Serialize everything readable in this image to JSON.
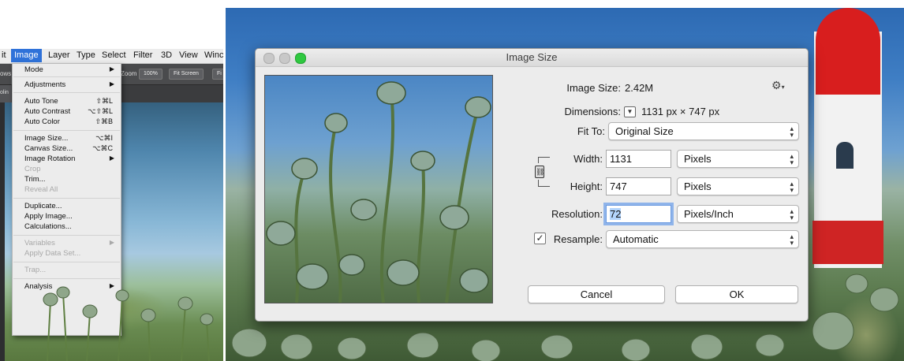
{
  "left": {
    "menubar": [
      "it",
      "Image",
      "Layer",
      "Type",
      "Select",
      "Filter",
      "3D",
      "View",
      "Winc"
    ],
    "options_bar": {
      "zoom_label": "Zoom",
      "zoom_value": "100%",
      "fit_screen": "Fit Screen",
      "stub": "Fi",
      "left_stub": "ows"
    },
    "tab_stub": "olin",
    "menu": [
      {
        "label": "Mode",
        "arrow": true
      },
      {
        "label": "Adjustments",
        "arrow": true
      },
      {
        "label": "Auto Tone",
        "shortcut": "⇧⌘L"
      },
      {
        "label": "Auto Contrast",
        "shortcut": "⌥⇧⌘L"
      },
      {
        "label": "Auto Color",
        "shortcut": "⇧⌘B"
      },
      {
        "label": "Image Size...",
        "shortcut": "⌥⌘I"
      },
      {
        "label": "Canvas Size...",
        "shortcut": "⌥⌘C"
      },
      {
        "label": "Image Rotation",
        "arrow": true
      },
      {
        "label": "Crop",
        "disabled": true
      },
      {
        "label": "Trim..."
      },
      {
        "label": "Reveal All",
        "disabled": true
      },
      {
        "label": "Duplicate..."
      },
      {
        "label": "Apply Image..."
      },
      {
        "label": "Calculations..."
      },
      {
        "label": "Variables",
        "arrow": true,
        "disabled": true
      },
      {
        "label": "Apply Data Set...",
        "disabled": true
      },
      {
        "label": "Trap...",
        "disabled": true
      },
      {
        "label": "Analysis",
        "arrow": true
      }
    ],
    "arrow_glyph": "▶"
  },
  "dialog": {
    "title": "Image Size",
    "image_size_label": "Image Size:",
    "image_size_value": "2.42M",
    "dimensions_label": "Dimensions:",
    "dimensions_value": "1131 px  ×  747 px",
    "fit_to_label": "Fit To:",
    "fit_to_value": "Original Size",
    "width_label": "Width:",
    "width_value": "1131",
    "width_unit": "Pixels",
    "height_label": "Height:",
    "height_value": "747",
    "height_unit": "Pixels",
    "resolution_label": "Resolution:",
    "resolution_value": "72",
    "resolution_unit": "Pixels/Inch",
    "resample_label": "Resample:",
    "resample_checked": true,
    "resample_value": "Automatic",
    "cancel": "Cancel",
    "ok": "OK",
    "gear_icon": "gear-icon",
    "colors": {
      "traffic_close": "#c5c5c5",
      "traffic_min": "#c5c5c5",
      "traffic_zoom": "#2fc840",
      "focus": "#8fb4ea"
    }
  }
}
